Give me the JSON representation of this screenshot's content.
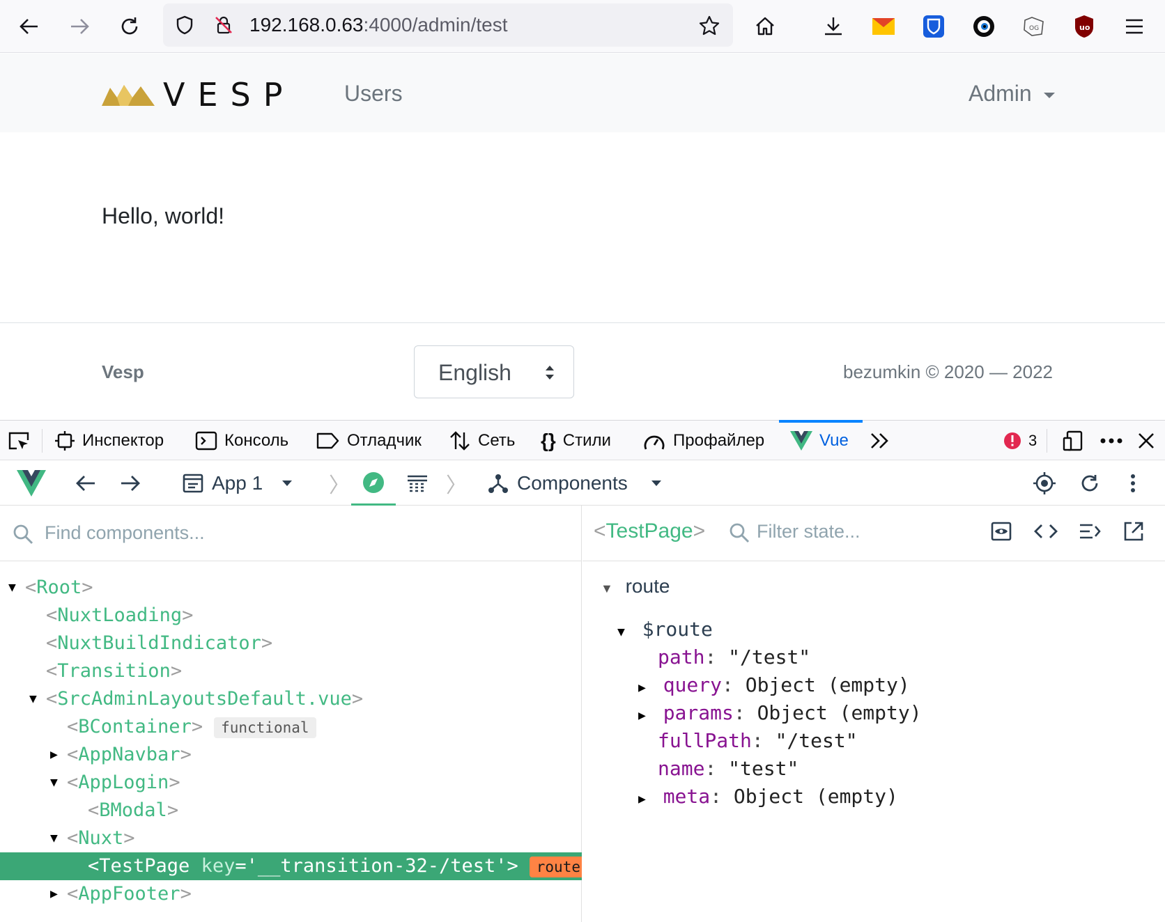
{
  "browser": {
    "url_host": "192.168.0.63",
    "url_rest": ":4000/admin/test"
  },
  "site": {
    "brand": "VESP",
    "nav_users": "Users",
    "nav_admin": "Admin",
    "hello": "Hello, world!",
    "footer_brand": "Vesp",
    "language": "English",
    "copyright": "bezumkin © 2020 — 2022"
  },
  "devtools": {
    "tabs": {
      "inspector": "Инспектор",
      "console": "Консоль",
      "debugger": "Отладчик",
      "network": "Сеть",
      "styles": "Стили",
      "profiler": "Профайлер",
      "vue": "Vue"
    },
    "error_count": "3"
  },
  "vue": {
    "app": "App 1",
    "section": "Components",
    "find_placeholder": "Find components...",
    "filter_placeholder": "Filter state...",
    "selected_component": "TestPage",
    "tree": {
      "root": "Root",
      "nuxt_loading": "NuxtLoading",
      "nuxt_build": "NuxtBuildIndicator",
      "transition": "Transition",
      "layout": "SrcAdminLayoutsDefault.vue",
      "bcontainer": "BContainer",
      "functional_badge": "functional",
      "app_navbar": "AppNavbar",
      "app_login": "AppLogin",
      "bmodal": "BModal",
      "nuxt": "Nuxt",
      "test_page": "TestPage",
      "test_page_key_attr": "key",
      "test_page_key_val": "'__transition-32-/test'",
      "router_badge": "router-view",
      "app_footer": "AppFooter"
    },
    "state": {
      "section": "route",
      "object": "$route",
      "path_key": "path",
      "path_val": "\"/test\"",
      "query_key": "query",
      "query_val": "Object (empty)",
      "params_key": "params",
      "params_val": "Object (empty)",
      "fullpath_key": "fullPath",
      "fullpath_val": "\"/test\"",
      "name_key": "name",
      "name_val": "\"test\"",
      "meta_key": "meta",
      "meta_val": "Object (empty)"
    }
  },
  "colors": {
    "vue_green": "#42b983",
    "selected_row": "#3ba776",
    "router_badge": "#ff8344",
    "key_purple": "#881391"
  }
}
